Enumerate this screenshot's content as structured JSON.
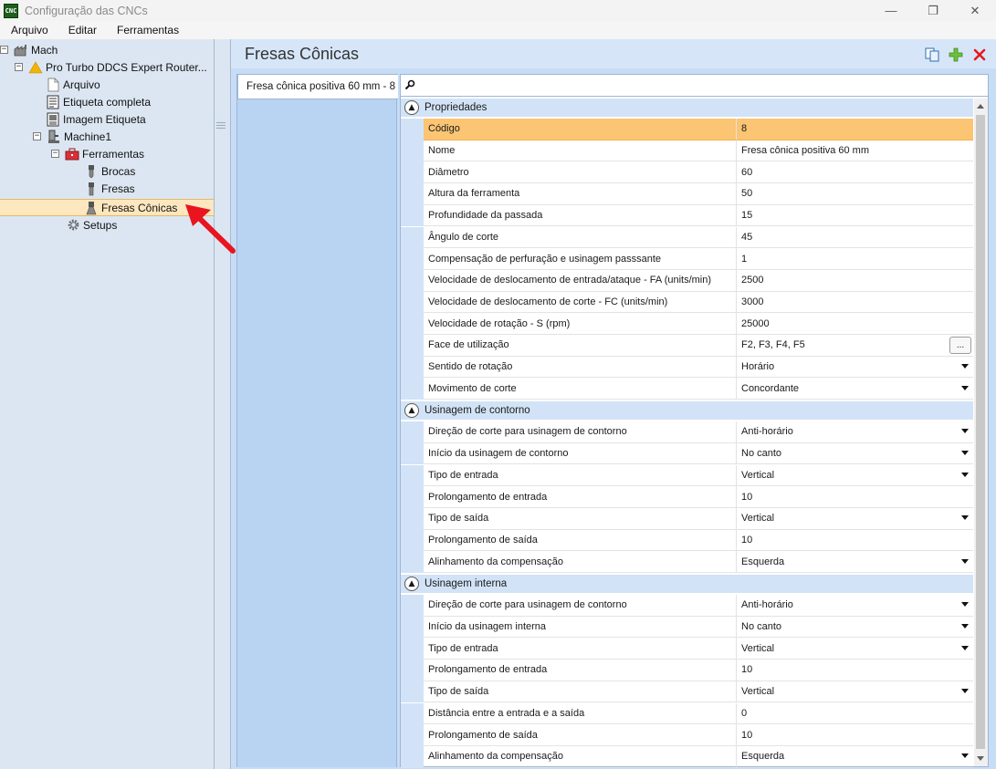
{
  "window": {
    "app_icon": "CNC",
    "title": "Configuração das CNCs",
    "controls": [
      "—",
      "❐",
      "✕"
    ]
  },
  "menu": [
    "Arquivo",
    "Editar",
    "Ferramentas"
  ],
  "tree": {
    "items": [
      {
        "label": "Mach",
        "icon": "factory-icon"
      },
      {
        "label": "Pro Turbo  DDCS  Expert  Router...",
        "icon": "warning-icon"
      },
      {
        "label": "Arquivo",
        "icon": "file-icon"
      },
      {
        "label": "Etiqueta completa",
        "icon": "label-icon"
      },
      {
        "label": "Imagem Etiqueta",
        "icon": "image-label-icon"
      },
      {
        "label": "Machine1",
        "icon": "machine-icon"
      },
      {
        "label": "Ferramentas",
        "icon": "toolbox-icon"
      },
      {
        "label": "Brocas",
        "icon": "drill-icon"
      },
      {
        "label": "Fresas",
        "icon": "mill-icon"
      },
      {
        "label": "Fresas Cônicas",
        "icon": "conical-mill-icon"
      },
      {
        "label": "Setups",
        "icon": "gear-icon"
      }
    ]
  },
  "main": {
    "title": "Fresas Cônicas",
    "toolbar": [
      "copy-icon",
      "add-icon",
      "delete-icon"
    ],
    "list_item": "Fresa cônica positiva 60 mm - 8",
    "search_placeholder": ""
  },
  "grid": {
    "categories": [
      {
        "name": "Propriedades",
        "rows": [
          {
            "name": "Código",
            "value": "8",
            "type": "text"
          },
          {
            "name": "Nome",
            "value": "Fresa cônica positiva 60 mm",
            "type": "text"
          },
          {
            "name": "Diâmetro",
            "value": "60",
            "type": "text"
          },
          {
            "name": "Altura da ferramenta",
            "value": "50",
            "type": "text"
          },
          {
            "name": "Profundidade da passada",
            "value": "15",
            "type": "text"
          },
          {
            "name": "Ângulo de corte",
            "value": "45",
            "type": "text"
          },
          {
            "name": "Compensação de perfuração e usinagem passsante",
            "value": "1",
            "type": "text"
          },
          {
            "name": "Velocidade de deslocamento de entrada/ataque - FA (units/min)",
            "value": "2500",
            "type": "text"
          },
          {
            "name": "Velocidade de deslocamento de corte - FC (units/min)",
            "value": "3000",
            "type": "text"
          },
          {
            "name": "Velocidade de rotação - S (rpm)",
            "value": "25000",
            "type": "text"
          },
          {
            "name": "Face de utilização",
            "value": "F2, F3, F4, F5",
            "type": "ellipsis"
          },
          {
            "name": "Sentido de rotação",
            "value": "Horário",
            "type": "dropdown"
          },
          {
            "name": "Movimento de corte",
            "value": "Concordante",
            "type": "dropdown"
          }
        ]
      },
      {
        "name": "Usinagem de contorno",
        "rows": [
          {
            "name": "Direção de corte para usinagem de contorno",
            "value": "Anti-horário",
            "type": "dropdown"
          },
          {
            "name": "Início da usinagem de contorno",
            "value": "No canto",
            "type": "dropdown"
          },
          {
            "name": "Tipo de entrada",
            "value": "Vertical",
            "type": "dropdown"
          },
          {
            "name": "Prolongamento de entrada",
            "value": "10",
            "type": "text"
          },
          {
            "name": "Tipo de saída",
            "value": "Vertical",
            "type": "dropdown"
          },
          {
            "name": "Prolongamento de saída",
            "value": "10",
            "type": "text"
          },
          {
            "name": "Alinhamento da compensação",
            "value": "Esquerda",
            "type": "dropdown"
          }
        ]
      },
      {
        "name": "Usinagem interna",
        "rows": [
          {
            "name": "Direção de corte para usinagem de contorno",
            "value": "Anti-horário",
            "type": "dropdown"
          },
          {
            "name": "Início da usinagem interna",
            "value": "No canto",
            "type": "dropdown"
          },
          {
            "name": "Tipo de entrada",
            "value": "Vertical",
            "type": "dropdown"
          },
          {
            "name": "Prolongamento de entrada",
            "value": "10",
            "type": "text"
          },
          {
            "name": "Tipo de saída",
            "value": "Vertical",
            "type": "dropdown"
          },
          {
            "name": "Distância entre a entrada e a saída",
            "value": "0",
            "type": "text"
          },
          {
            "name": "Prolongamento de saída",
            "value": "10",
            "type": "text"
          },
          {
            "name": "Alinhamento da compensação",
            "value": "Esquerda",
            "type": "dropdown"
          }
        ]
      }
    ]
  },
  "colors": {
    "selection": "#fbc573",
    "tree_selection": "#fde7bf",
    "panel": "#dce6f2",
    "category": "#d2e3f7",
    "annotation_arrow": "#e8141e"
  }
}
